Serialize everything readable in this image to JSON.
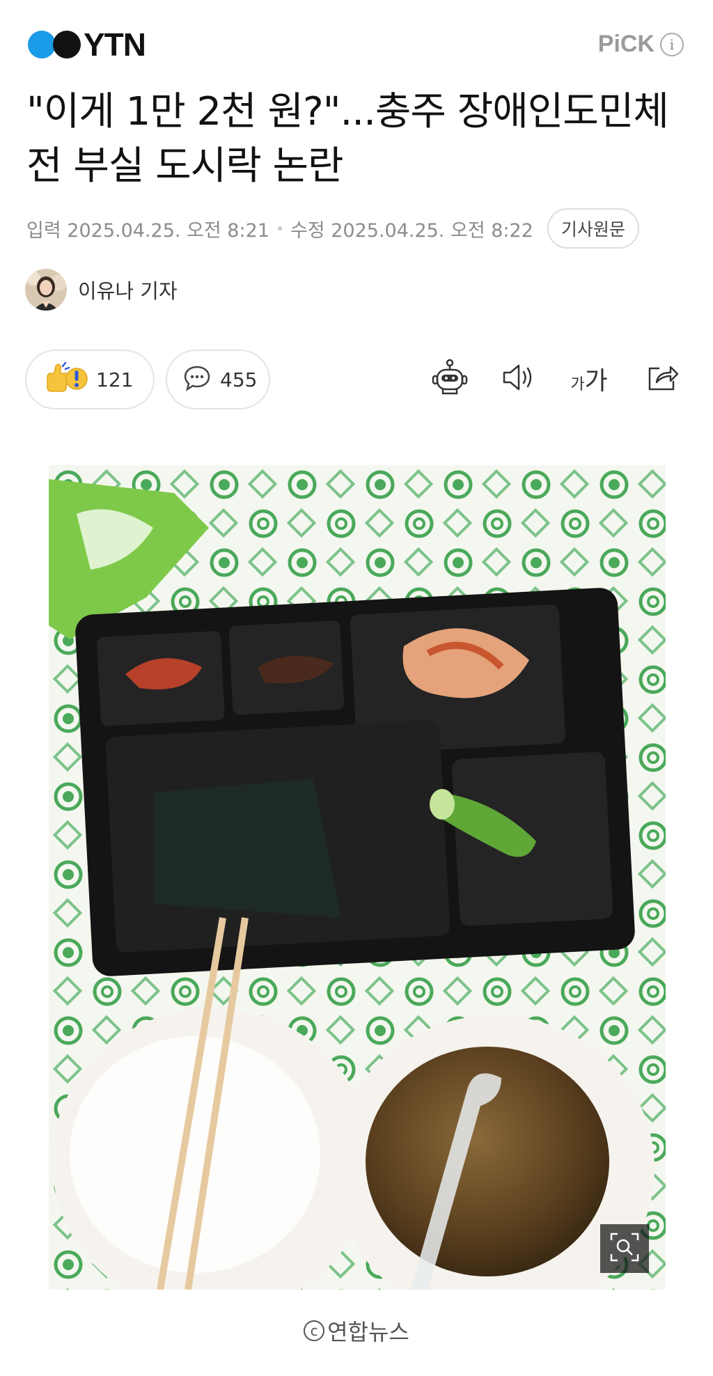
{
  "header": {
    "logo_text": "YTN",
    "pick_label": "PiCK",
    "info_glyph": "i"
  },
  "article": {
    "title": "\"이게 1만 2천 원?\"...충주 장애인도민체전 부실 도시락 논란",
    "input_label": "입력",
    "input_datetime": "2025.04.25. 오전 8:21",
    "edit_label": "수정",
    "edit_datetime": "2025.04.25. 오전 8:22",
    "original_button": "기사원문",
    "author": "이유나 기자"
  },
  "actions": {
    "reaction_count": "121",
    "comment_count": "455",
    "font_small": "가",
    "font_large": "가",
    "icons": [
      "reaction-emoji-icon",
      "comment-icon",
      "robot-summary-icon",
      "speaker-icon",
      "font-size-icon",
      "share-icon"
    ]
  },
  "photo": {
    "credit": "연합뉴스",
    "credit_symbol": "c"
  },
  "colors": {
    "logo_blue": "#1a9be8",
    "meta_gray": "#8c8c8c",
    "border_gray": "#e4e4e4"
  }
}
